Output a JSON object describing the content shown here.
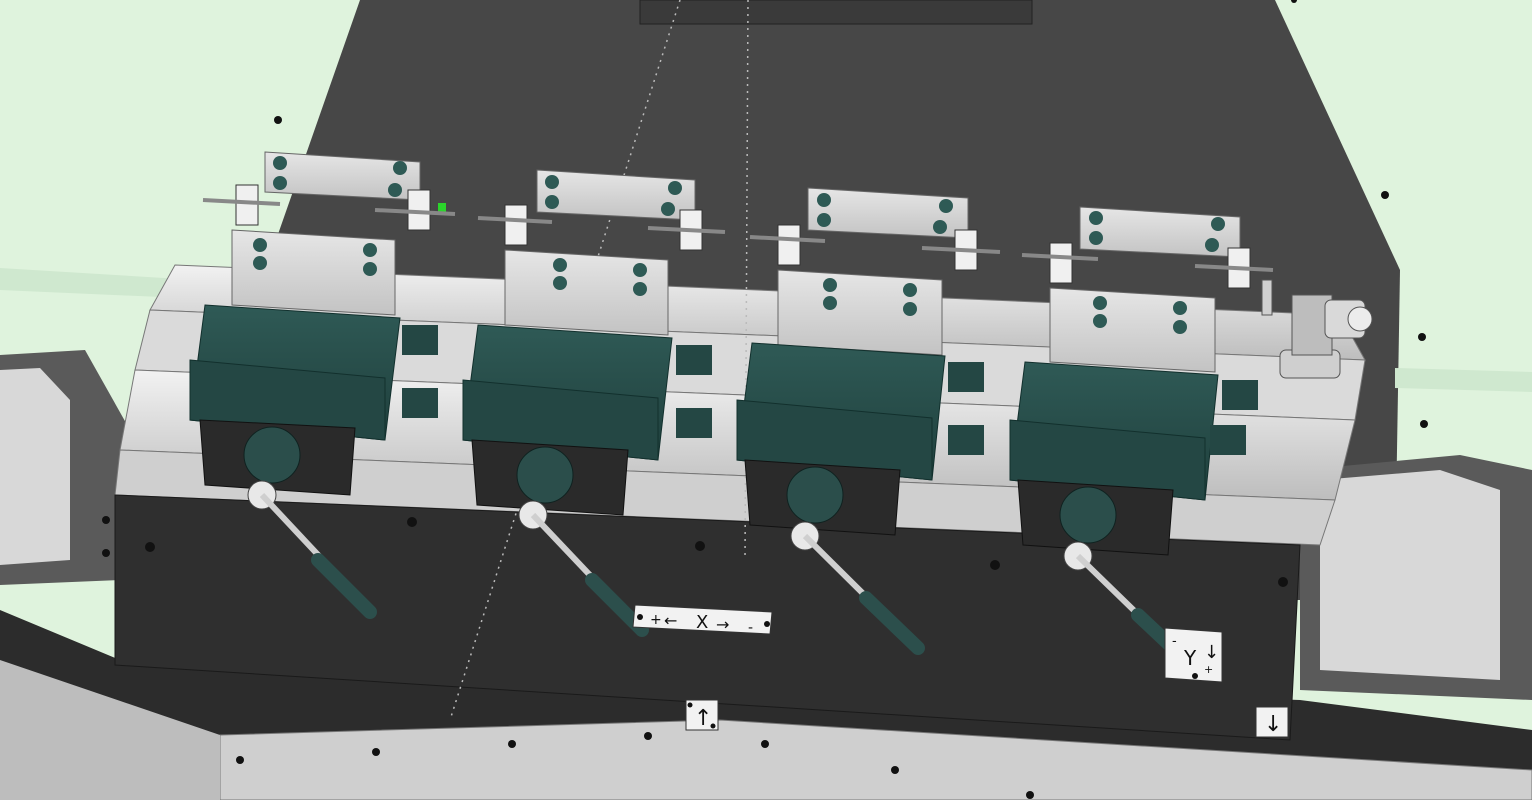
{
  "colors": {
    "background": "#dff3dd",
    "machine_body": "#474747",
    "fixture_plate": "#2f2f2f",
    "rail_light": "#e4e4e4",
    "vise_green": "#254a47",
    "block_gray": "#d3d3d3",
    "indicator_green": "#2bd42b"
  },
  "labels": {
    "x_axis": {
      "plus": "+",
      "minus": "-",
      "left_arrow": "←",
      "letter": "X",
      "right_arrow": "→"
    },
    "y_axis": {
      "minus": "-",
      "letter": "Y",
      "arrow": "↓",
      "plus": "+"
    },
    "center_arrow": "↑",
    "right_arrow": "↓"
  },
  "vises": [
    {
      "id": "vise-1",
      "indicator": "green"
    },
    {
      "id": "vise-2",
      "indicator": "none"
    },
    {
      "id": "vise-3",
      "indicator": "none"
    },
    {
      "id": "vise-4",
      "indicator": "none"
    }
  ]
}
